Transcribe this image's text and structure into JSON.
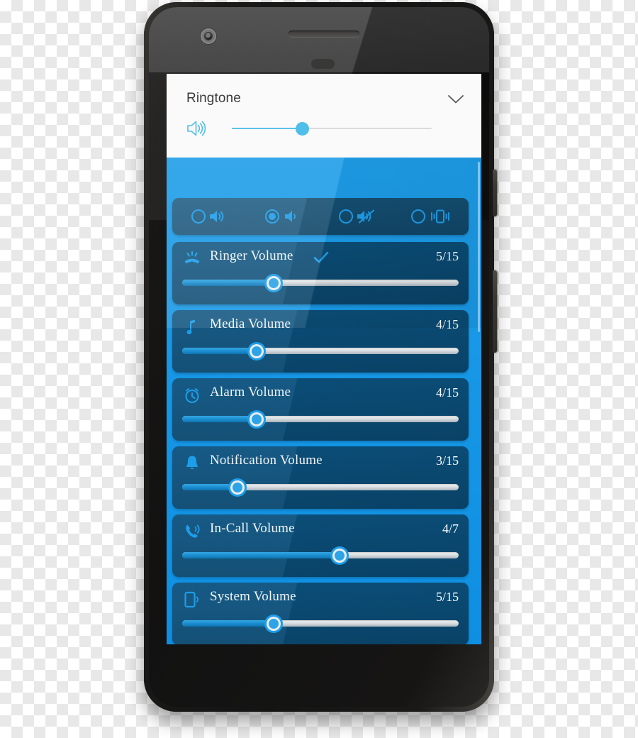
{
  "device": {
    "name": "android-smartphone-mockup",
    "camera_icon": "front-camera-icon",
    "speaker_icon": "earpiece-speaker",
    "sensor_icon": "proximity-sensor",
    "power_button": "power-button",
    "volume_button": "volume-rocker-button"
  },
  "colors": {
    "screen_background": "#1E9DE8",
    "card_background": "#0C5380",
    "mode_card_background": "#17587F",
    "accent": "#1E9DE8",
    "header_accent": "#4FBEE8",
    "text_light": "#F2F6F8",
    "header_text": "#3b3b3b",
    "track_inactive": "#D2D8DD"
  },
  "header": {
    "title": "Ringtone",
    "chevron_icon": "chevron-down-icon",
    "speaker_icon": "volume-high-icon",
    "slider": {
      "percent": 35,
      "value": 5,
      "max": 15
    }
  },
  "mode_selector": {
    "options": [
      {
        "id": "loud",
        "icon": "volume-high-icon",
        "selected": false
      },
      {
        "id": "medium",
        "icon": "volume-low-icon",
        "selected": true
      },
      {
        "id": "mute",
        "icon": "volume-mute-icon",
        "selected": false
      },
      {
        "id": "vibrate",
        "icon": "vibrate-icon",
        "selected": false
      }
    ]
  },
  "volume_rows": [
    {
      "icon": "ringing-phone-icon",
      "label": "Ringer Volume",
      "value": 5,
      "max": 15,
      "value_text": "5/15",
      "percent": 33,
      "checked": true,
      "check_icon": "check-icon"
    },
    {
      "icon": "music-note-icon",
      "label": "Media Volume",
      "value": 4,
      "max": 15,
      "value_text": "4/15",
      "percent": 27,
      "checked": false
    },
    {
      "icon": "alarm-clock-icon",
      "label": "Alarm Volume",
      "value": 4,
      "max": 15,
      "value_text": "4/15",
      "percent": 27,
      "checked": false
    },
    {
      "icon": "bell-icon",
      "label": "Notification Volume",
      "value": 3,
      "max": 15,
      "value_text": "3/15",
      "percent": 20,
      "checked": false
    },
    {
      "icon": "phone-in-call-icon",
      "label": "In-Call Volume",
      "value": 4,
      "max": 7,
      "value_text": "4/7",
      "percent": 57,
      "checked": false
    },
    {
      "icon": "phone-system-icon",
      "label": "System Volume",
      "value": 5,
      "max": 15,
      "value_text": "5/15",
      "percent": 33,
      "checked": false
    }
  ]
}
